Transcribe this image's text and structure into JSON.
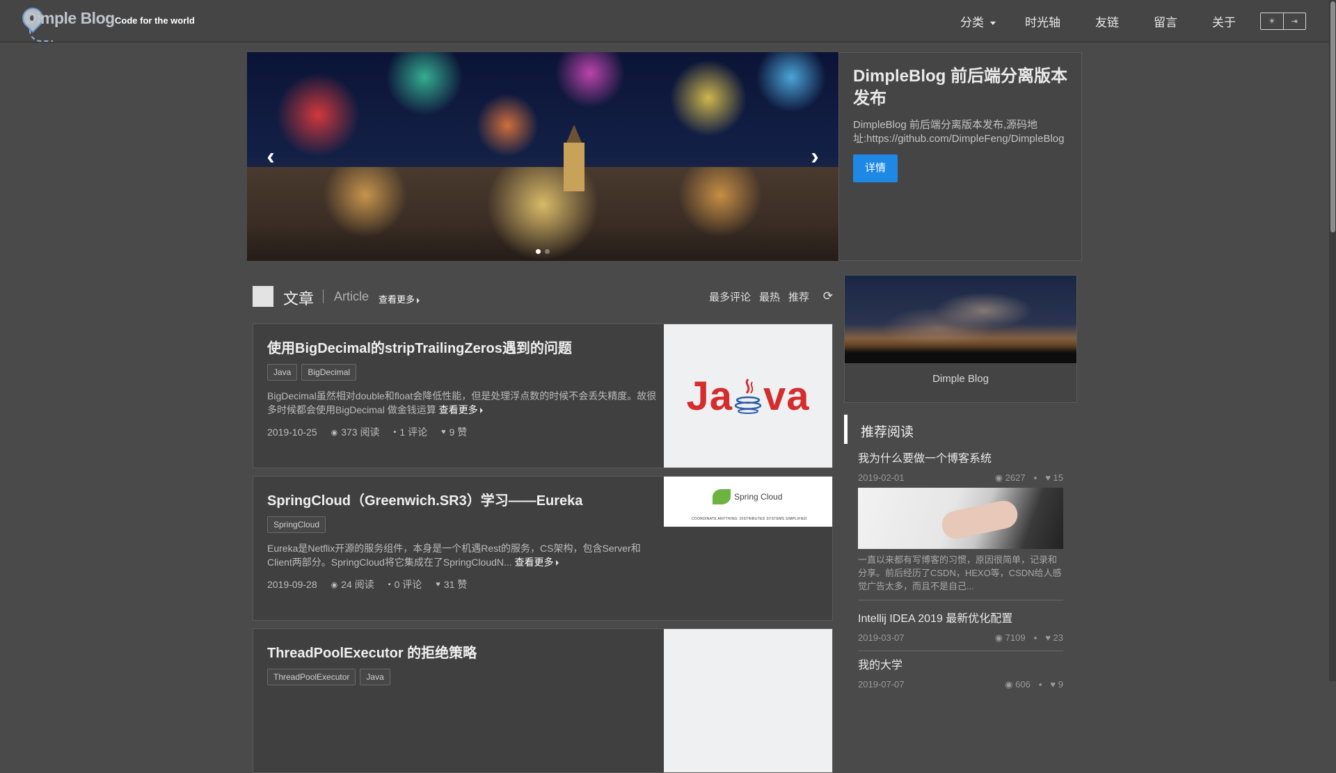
{
  "header": {
    "logo_text": "Dimple Blog",
    "slogan": "Code for the world",
    "nav": [
      "分类",
      "时光轴",
      "友链",
      "留言",
      "关于"
    ],
    "toggle": [
      "☀",
      "⇥"
    ]
  },
  "carousel": {
    "prev": "‹",
    "next": "›",
    "slide_count": 2,
    "active_slide": 1
  },
  "featured": {
    "title": "DimpleBlog 前后端分离版本发布",
    "desc": "DimpleBlog 前后端分离版本发布,源码地址:https://github.com/DimpleFeng/DimpleBlog",
    "button": "详情"
  },
  "articles_section": {
    "title_zh": "文章",
    "title_en": "Article",
    "more": "查看更多",
    "sorts": [
      "最多评论",
      "最热",
      "推荐"
    ],
    "refresh_icon": "⟳"
  },
  "articles": [
    {
      "title": "使用BigDecimal的stripTrailingZeros遇到的问题",
      "tags": [
        "Java",
        "BigDecimal"
      ],
      "desc": "BigDecimal虽然相对double和float会降低性能，但是处理浮点数的时候不会丢失精度。故很多时候都会使用BigDecimal 做金钱运算",
      "more": "查看更多",
      "date": "2019-10-25",
      "reads": "373 阅读",
      "comments": "1 评论",
      "likes": "9 赞",
      "image": "java-logo"
    },
    {
      "title": "SpringCloud（Greenwich.SR3）学习——Eureka",
      "tags": [
        "SpringCloud"
      ],
      "desc": "Eureka是Netflix开源的服务组件，本身是一个机遇Rest的服务，CS架构，包含Server和Client两部分。SpringCloud将它集成在了SpringCloudN...",
      "more": "查看更多",
      "date": "2019-09-28",
      "reads": "24 阅读",
      "comments": "0 评论",
      "likes": "31 赞",
      "image": "spring-cloud-logo",
      "image_text": "Spring Cloud",
      "image_subtext": "COORDINATE ANYTHING: DISTRIBUTED SYSTEMS SIMPLIFIED"
    },
    {
      "title": "ThreadPoolExecutor 的拒绝策略",
      "tags": [
        "ThreadPoolExecutor",
        "Java"
      ],
      "image": "blank"
    }
  ],
  "profile": {
    "name": "Dimple Blog"
  },
  "recommended": {
    "title": "推荐阅读",
    "items": [
      {
        "title": "我为什么要做一个博客系统",
        "date": "2019-02-01",
        "reads": "2627",
        "likes": "15",
        "desc": "一直以来都有写博客的习惯，原因很简单，记录和分享。前后经历了CSDN，HEXO等，CSDN给人感觉广告太多，而且不是自己..."
      },
      {
        "title": "Intellij IDEA 2019 最新优化配置",
        "date": "2019-03-07",
        "reads": "7109",
        "likes": "23"
      },
      {
        "title": "我的大学",
        "date": "2019-07-07",
        "reads": "606",
        "likes": "9"
      }
    ]
  },
  "icons": {
    "eye": "◉",
    "comment": "▪",
    "heart": "♥"
  }
}
